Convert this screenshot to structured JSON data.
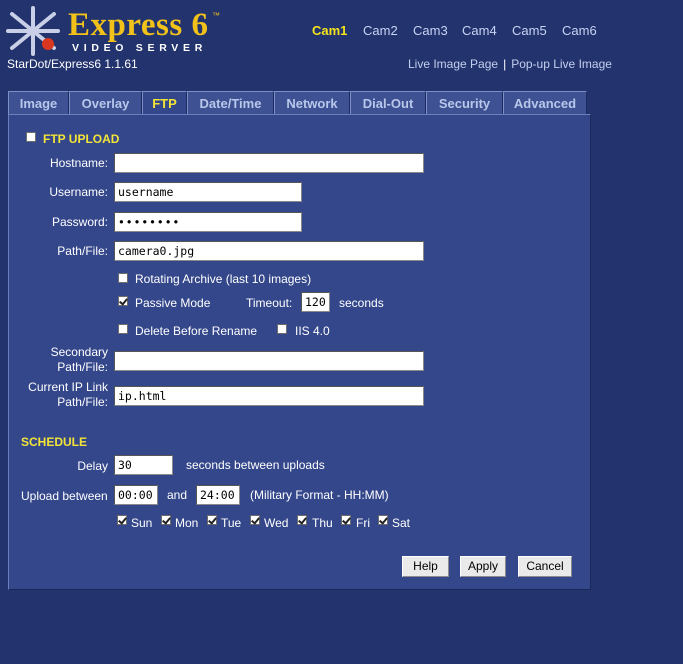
{
  "header": {
    "brand_name": "Express 6",
    "trademark": "™",
    "brand_sub": "VIDEO SERVER",
    "version": "StarDot/Express6 1.1.61",
    "cams": [
      "Cam1",
      "Cam2",
      "Cam3",
      "Cam4",
      "Cam5",
      "Cam6"
    ],
    "active_cam": "Cam1",
    "live_image_link": "Live Image Page",
    "separator": "|",
    "popup_link": "Pop-up Live Image"
  },
  "tabs": [
    "Image",
    "Overlay",
    "FTP",
    "Date/Time",
    "Network",
    "Dial-Out",
    "Security",
    "Advanced"
  ],
  "active_tab": "FTP",
  "ftp": {
    "title": "FTP UPLOAD",
    "enabled": false,
    "hostname_label": "Hostname:",
    "hostname_value": "",
    "username_label": "Username:",
    "username_value": "username",
    "password_label": "Password:",
    "password_value": "••••••••",
    "path_label": "Path/File:",
    "path_value": "camera0.jpg",
    "rotating_label": "Rotating Archive (last 10 images)",
    "rotating_checked": false,
    "passive_label": "Passive Mode",
    "passive_checked": true,
    "timeout_label": "Timeout:",
    "timeout_value": "120",
    "timeout_unit": "seconds",
    "delete_label": "Delete Before Rename",
    "delete_checked": false,
    "iis_label": "IIS 4.0",
    "iis_checked": false,
    "secondary_label_1": "Secondary",
    "secondary_label_2": "Path/File:",
    "secondary_value": "",
    "current_ip_label_1": "Current IP Link",
    "current_ip_label_2": "Path/File:",
    "current_ip_value": "ip.html"
  },
  "schedule": {
    "title": "SCHEDULE",
    "delay_label": "Delay",
    "delay_value": "30",
    "delay_unit": "seconds between uploads",
    "upload_label": "Upload between",
    "start_value": "00:00",
    "and_label": "and",
    "end_value": "24:00",
    "format_hint": "(Military Format - HH:MM)",
    "days": [
      {
        "label": "Sun",
        "checked": true
      },
      {
        "label": "Mon",
        "checked": true
      },
      {
        "label": "Tue",
        "checked": true
      },
      {
        "label": "Wed",
        "checked": true
      },
      {
        "label": "Thu",
        "checked": true
      },
      {
        "label": "Fri",
        "checked": true
      },
      {
        "label": "Sat",
        "checked": true
      }
    ]
  },
  "buttons": {
    "help": "Help",
    "apply": "Apply",
    "cancel": "Cancel"
  },
  "colors": {
    "background": "#22336d",
    "panel": "#34478b",
    "accent_yellow": "#f3e437",
    "brand_gold": "#f2c21a"
  }
}
